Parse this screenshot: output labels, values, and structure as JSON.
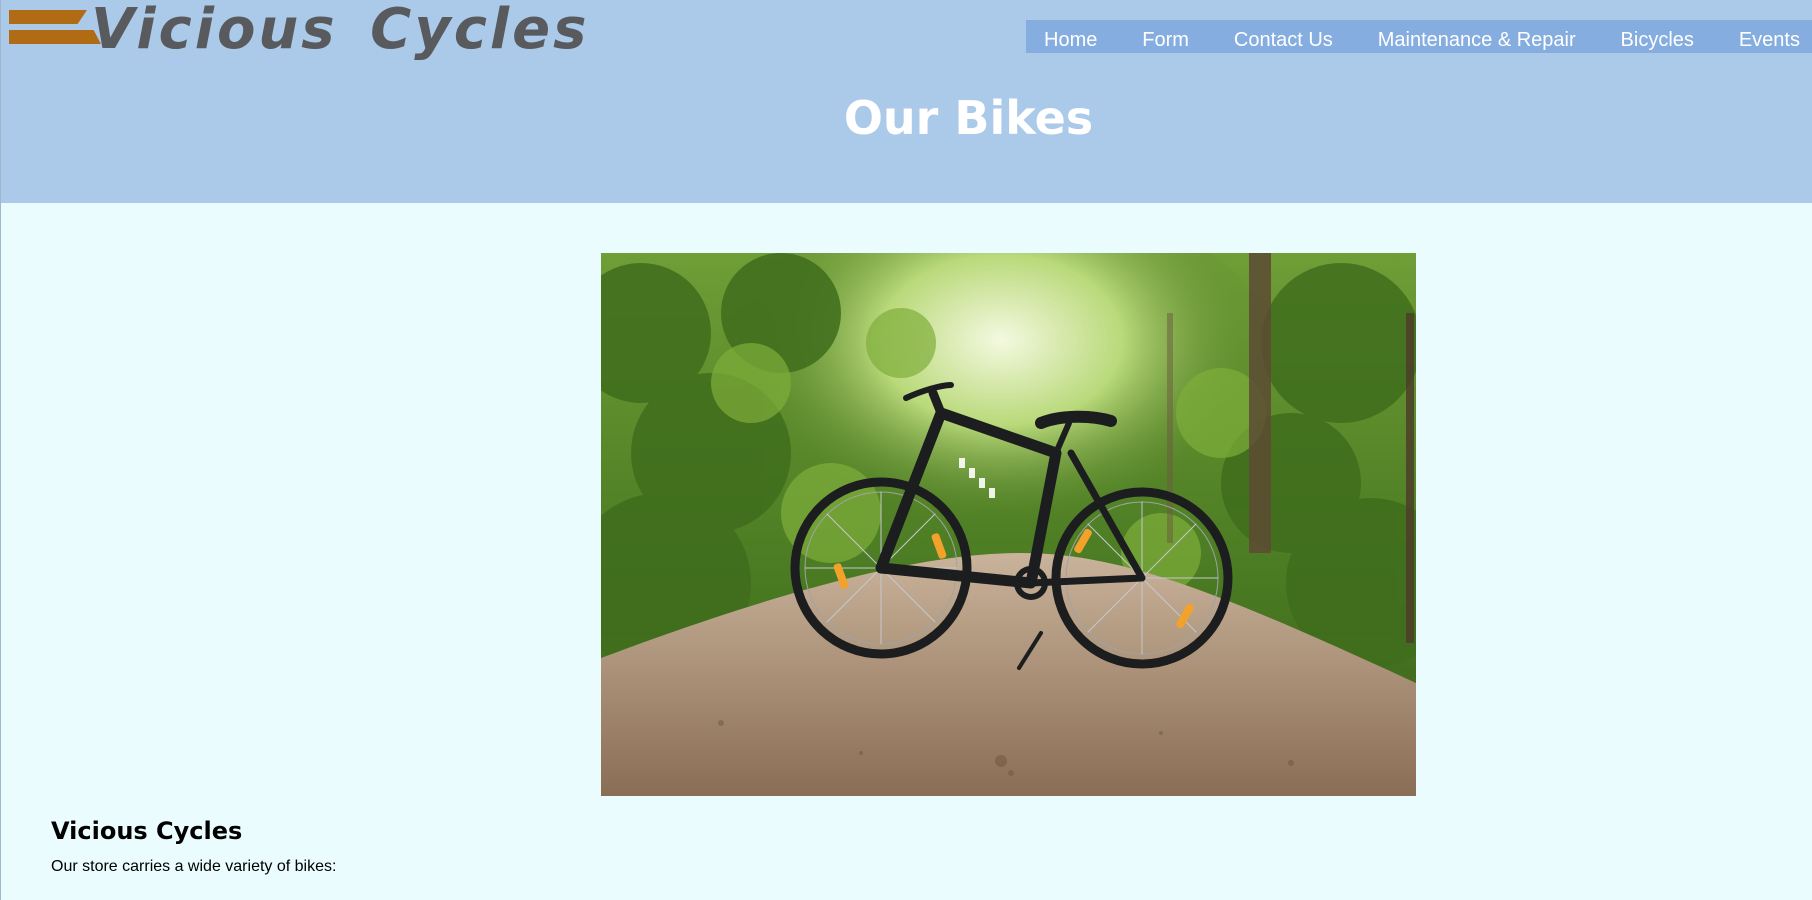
{
  "brand": {
    "name": "Vicious Cycles",
    "accent_color": "#b06b14",
    "text_color": "#585a5d"
  },
  "nav": {
    "items": [
      {
        "label": "Home"
      },
      {
        "label": "Form"
      },
      {
        "label": "Contact Us"
      },
      {
        "label": "Maintenance & Repair"
      },
      {
        "label": "Bicycles"
      },
      {
        "label": "Events"
      }
    ],
    "background": "#85ade0"
  },
  "header": {
    "title": "Our Bikes",
    "background": "#abc9e8"
  },
  "main": {
    "hero_image": {
      "alt": "Bicycle on a forest path",
      "icon": "bicycle-photo"
    },
    "heading": "Vicious Cycles",
    "intro": "Our store carries a wide variety of bikes:",
    "background": "#eafcfe"
  }
}
